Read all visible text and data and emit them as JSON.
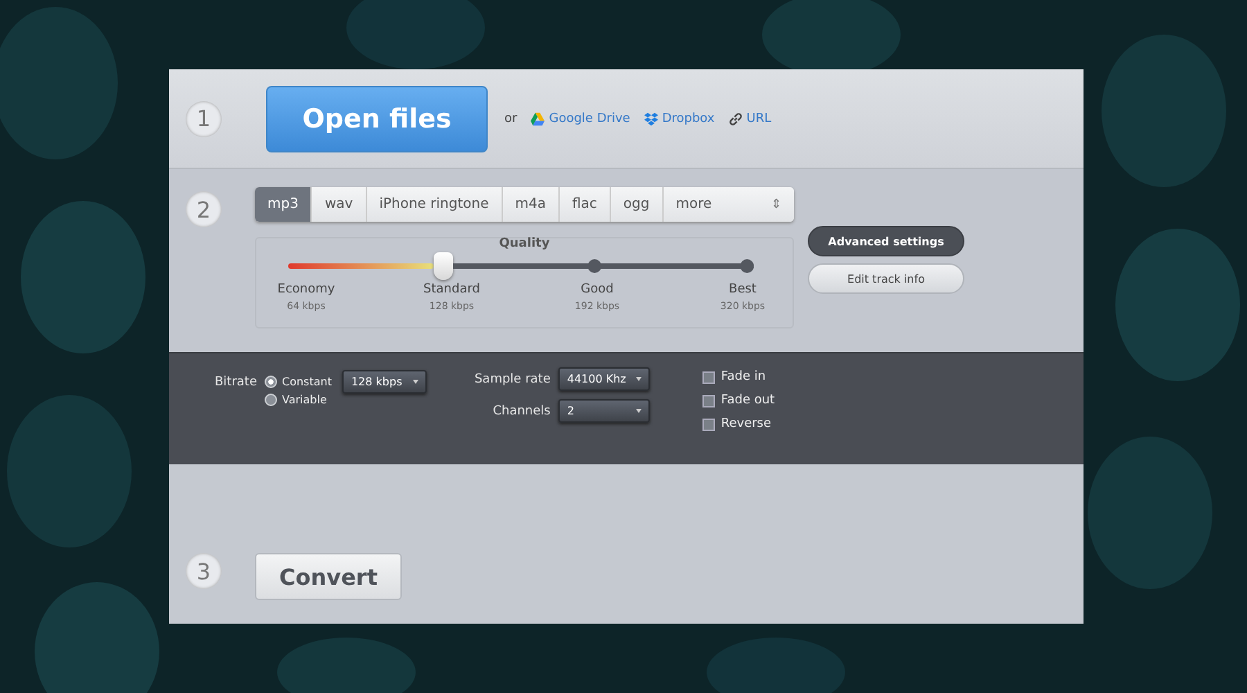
{
  "steps": [
    "1",
    "2",
    "3"
  ],
  "open": {
    "button": "Open files",
    "or": "or",
    "sources": [
      {
        "kind": "drive",
        "label": "Google Drive"
      },
      {
        "kind": "dropbox",
        "label": "Dropbox"
      },
      {
        "kind": "url",
        "label": "URL"
      }
    ]
  },
  "formats": [
    {
      "label": "mp3",
      "selected": true
    },
    {
      "label": "wav",
      "selected": false
    },
    {
      "label": "iPhone ringtone",
      "selected": false
    },
    {
      "label": "m4a",
      "selected": false
    },
    {
      "label": "flac",
      "selected": false
    },
    {
      "label": "ogg",
      "selected": false
    }
  ],
  "more": {
    "label": "more",
    "arrows": "⇕"
  },
  "quality": {
    "title": "Quality",
    "level": 0.333,
    "stops": [
      {
        "label": "Economy",
        "rate": "64 kbps"
      },
      {
        "label": "Standard",
        "rate": "128 kbps"
      },
      {
        "label": "Good",
        "rate": "192 kbps"
      },
      {
        "label": "Best",
        "rate": "320 kbps"
      }
    ]
  },
  "side_buttons": [
    {
      "label": "Advanced settings",
      "selected": true
    },
    {
      "label": "Edit track info",
      "selected": false
    }
  ],
  "advanced": {
    "bitrate_label": "Bitrate",
    "modes": [
      {
        "label": "Constant",
        "selected": true
      },
      {
        "label": "Variable",
        "selected": false
      }
    ],
    "bitrate": "128 kbps",
    "sample_rate_label": "Sample rate",
    "sample_rate": "44100 Khz",
    "channels_label": "Channels",
    "channels": "2",
    "effects": [
      {
        "label": "Fade in",
        "checked": false
      },
      {
        "label": "Fade out",
        "checked": false
      },
      {
        "label": "Reverse",
        "checked": false
      }
    ]
  },
  "convert": "Convert"
}
